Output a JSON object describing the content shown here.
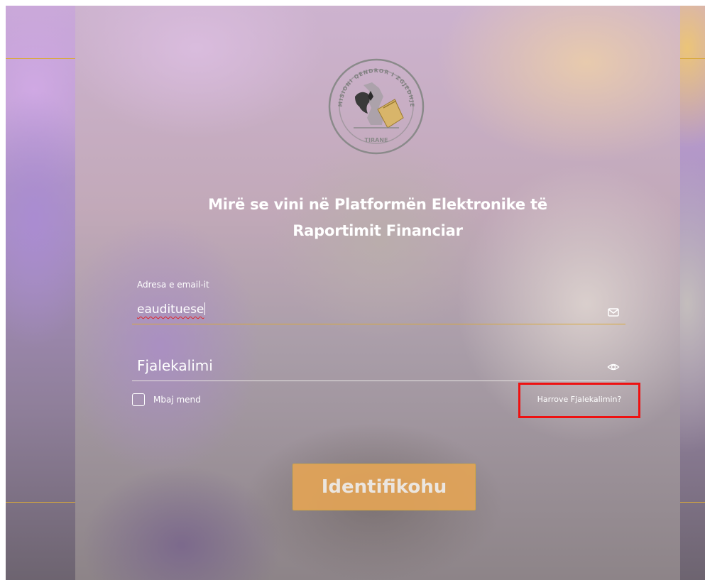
{
  "logo": {
    "top_text": "KOMISIONI QENDROR I ZGJEDHJEVE",
    "bottom_text": "TIRANE",
    "icon": "kqz-seal-logo"
  },
  "welcome": {
    "line1": "Mirë se vini në Platformën Elektronike të",
    "line2": "Raportimit Financiar"
  },
  "email_field": {
    "label": "Adresa e email-it",
    "value": "eaudituese",
    "icon": "mail-icon"
  },
  "password_field": {
    "placeholder": "Fjalekalimi",
    "icon": "eye-icon"
  },
  "remember": {
    "label": "Mbaj mend",
    "checked": false
  },
  "forgot": {
    "label": "Harrove Fjalekalimin?",
    "highlight_color": "#ee1111"
  },
  "login": {
    "label": "Identifikohu"
  },
  "colors": {
    "accent": "#d9a93a",
    "button": "#e3a457"
  }
}
